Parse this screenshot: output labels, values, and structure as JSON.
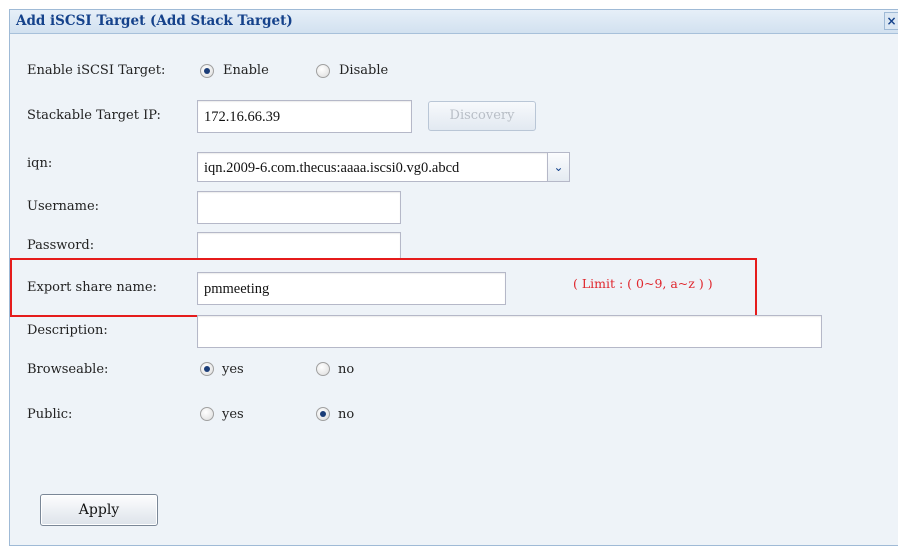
{
  "dialog": {
    "title": "Add iSCSI Target (Add Stack Target)",
    "close_glyph": "×"
  },
  "form": {
    "enable_target": {
      "label": "Enable iSCSI Target:",
      "options": [
        "Enable",
        "Disable"
      ],
      "selected": "Enable"
    },
    "target_ip": {
      "label": "Stackable Target IP:",
      "value": "172.16.66.39",
      "discovery_label": "Discovery"
    },
    "iqn": {
      "label": "iqn:",
      "value": "iqn.2009-6.com.thecus:aaaa.iscsi0.vg0.abcd",
      "arrow_glyph": "⌄"
    },
    "username": {
      "label": "Username:",
      "value": ""
    },
    "password": {
      "label": "Password:",
      "value": ""
    },
    "export_share": {
      "label": "Export share name:",
      "value": "pmmeeting",
      "limit_text": "( Limit : ( 0~9, a~z ) )"
    },
    "description": {
      "label": "Description:",
      "value": ""
    },
    "browseable": {
      "label": "Browseable:",
      "options": [
        "yes",
        "no"
      ],
      "selected": "yes"
    },
    "public": {
      "label": "Public:",
      "options": [
        "yes",
        "no"
      ],
      "selected": "no"
    },
    "apply_label": "Apply"
  },
  "colors": {
    "title_text": "#15428b",
    "highlight_box": "#e51b1b",
    "limit_text": "#e0262d",
    "panel_bg": "#eef3f8"
  },
  "icons": {
    "close": "close-icon",
    "dropdown": "chevron-down-icon"
  }
}
